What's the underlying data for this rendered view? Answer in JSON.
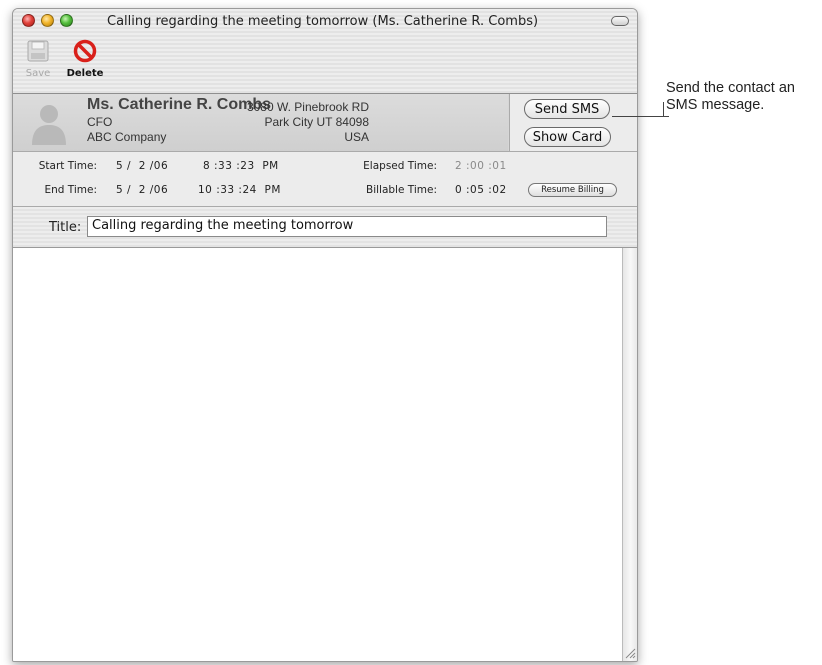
{
  "window": {
    "title": "Calling regarding the meeting tomorrow (Ms. Catherine R. Combs)"
  },
  "toolbar": {
    "save_label": "Save",
    "delete_label": "Delete"
  },
  "contact": {
    "name": "Ms. Catherine R. Combs",
    "job_title": "CFO",
    "company": "ABC Company",
    "address_line1": "3080 W. Pinebrook RD",
    "address_line2": "Park City UT 84098",
    "country": "USA",
    "send_sms_label": "Send SMS",
    "show_card_label": "Show Card"
  },
  "times": {
    "start_label": "Start Time:",
    "start_date": "5 /  2 /06",
    "start_time": "8 :33 :23  PM",
    "end_label": "End Time:",
    "end_date": "5 /  2 /06",
    "end_time": "10 :33 :24  PM",
    "elapsed_label": "Elapsed Time:",
    "elapsed_value": "2 :00 :01",
    "billable_label": "Billable Time:",
    "billable_value": "0 :05 :02",
    "resume_label": "Resume Billing"
  },
  "call_title": {
    "label": "Title:",
    "value": "Calling regarding the meeting tomorrow"
  },
  "callout": {
    "text": "Send the contact an SMS message."
  },
  "colors": {
    "delete_icon": "#d9201a",
    "window_bg": "#ececec",
    "contact_bg": "#d6d6d6"
  }
}
